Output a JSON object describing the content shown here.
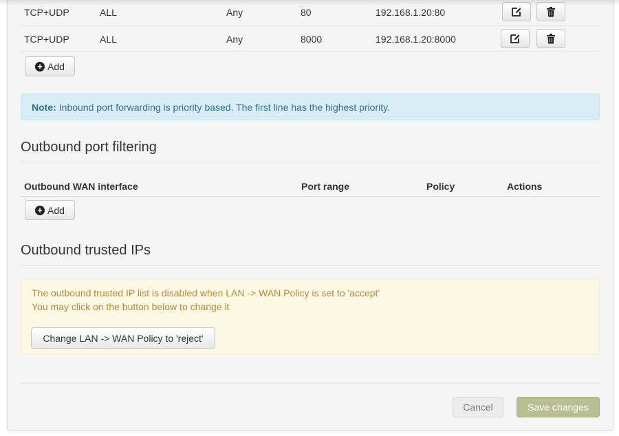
{
  "inbound": {
    "rows": [
      {
        "protocol": "TCP+UDP",
        "wan": "ALL",
        "source": "Any",
        "port": "80",
        "destination": "192.168.1.20:80"
      },
      {
        "protocol": "TCP+UDP",
        "wan": "ALL",
        "source": "Any",
        "port": "8000",
        "destination": "192.168.1.20:8000"
      }
    ],
    "add_label": "Add",
    "note_label": "Note:",
    "note_text": "Inbound port forwarding is priority based. The first line has the highest priority."
  },
  "outbound_filtering": {
    "title": "Outbound port filtering",
    "columns": [
      "Outbound WAN interface",
      "Port range",
      "Policy",
      "Actions"
    ],
    "add_label": "Add"
  },
  "outbound_trusted": {
    "title": "Outbound trusted IPs",
    "warning_line1": "The outbound trusted IP list is disabled when LAN -> WAN Policy is set to 'accept'",
    "warning_line2": "You may click on the button below to change it",
    "change_policy_label": "Change LAN -> WAN Policy to 'reject'"
  },
  "footer": {
    "cancel_label": "Cancel",
    "save_label": "Save changes"
  },
  "icons": {
    "edit": "edit-icon",
    "delete": "trash-icon",
    "add": "plus-circle-icon"
  },
  "colors": {
    "info_bg": "#d9edf7",
    "info_text": "#31708f",
    "warning_bg": "#fcf8e3",
    "warning_text": "#b58a3d",
    "save_button": "#b8be8f"
  }
}
